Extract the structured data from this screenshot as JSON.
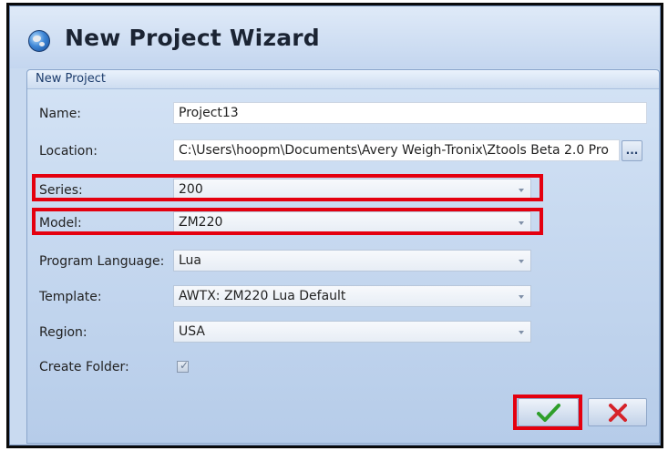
{
  "window": {
    "title": "New Project Wizard",
    "icon": "globe-icon"
  },
  "panel": {
    "header": "New Project"
  },
  "form": {
    "name": {
      "label": "Name:",
      "value": "Project13"
    },
    "location": {
      "label": "Location:",
      "value": "C:\\Users\\hoopm\\Documents\\Avery Weigh-Tronix\\Ztools Beta 2.0 Pro",
      "browse_label": "..."
    },
    "series": {
      "label": "Series:",
      "value": "200"
    },
    "model": {
      "label": "Model:",
      "value": "ZM220"
    },
    "language": {
      "label": "Program Language:",
      "value": "Lua"
    },
    "template": {
      "label": "Template:",
      "value": "AWTX: ZM220 Lua Default"
    },
    "region": {
      "label": "Region:",
      "value": "USA"
    },
    "create_folder": {
      "label": "Create Folder:",
      "checked": true
    }
  },
  "buttons": {
    "ok": {
      "icon": "checkmark-icon",
      "color": "#2e9e2a"
    },
    "cancel": {
      "icon": "close-icon",
      "color": "#d6232a"
    }
  },
  "colors": {
    "highlight": "#e4000f",
    "panel": "#c9daf0"
  }
}
